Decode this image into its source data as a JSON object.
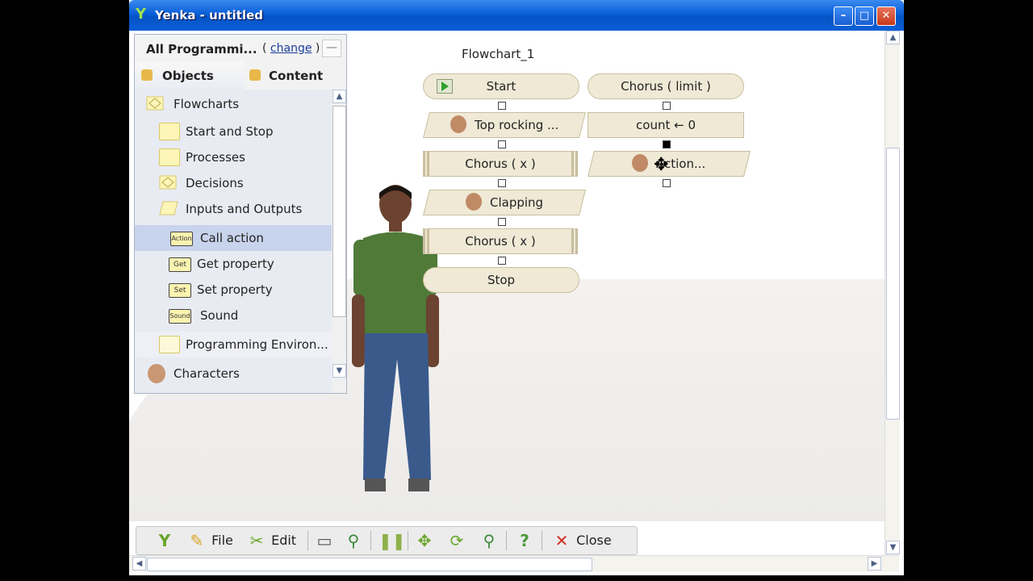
{
  "window": {
    "title": "Yenka - untitled",
    "minimize": "–",
    "maximize": "□",
    "close": "✕"
  },
  "panel": {
    "header_label": "All Programmi...",
    "change_open": "(",
    "change_link": "change",
    "change_close": ")",
    "minimize": "—",
    "tabs": [
      {
        "label": "Objects"
      },
      {
        "label": "Content"
      }
    ],
    "tree": [
      {
        "label": "Flowcharts"
      },
      {
        "label": "Start and Stop"
      },
      {
        "label": "Processes"
      },
      {
        "label": "Decisions"
      },
      {
        "label": "Inputs and Outputs"
      },
      {
        "label": "Call action",
        "tag": "Action"
      },
      {
        "label": "Get property",
        "tag": "Get"
      },
      {
        "label": "Set property",
        "tag": "Set"
      },
      {
        "label": "Sound",
        "tag": "Sound"
      },
      {
        "label": "Programming Environ..."
      },
      {
        "label": "Characters"
      }
    ]
  },
  "flowchart": {
    "title": "Flowchart_1",
    "left_column": [
      {
        "label": "Start"
      },
      {
        "label": "Top rocking  ..."
      },
      {
        "label": "Chorus ( x )"
      },
      {
        "label": "Clapping"
      },
      {
        "label": "Chorus ( x )"
      },
      {
        "label": "Stop"
      }
    ],
    "right_column": [
      {
        "label": "Chorus ( limit )"
      },
      {
        "label": "count  ← 0"
      },
      {
        "label": "Action..."
      }
    ]
  },
  "toolbar": {
    "file": "File",
    "edit": "Edit",
    "close": "Close"
  }
}
